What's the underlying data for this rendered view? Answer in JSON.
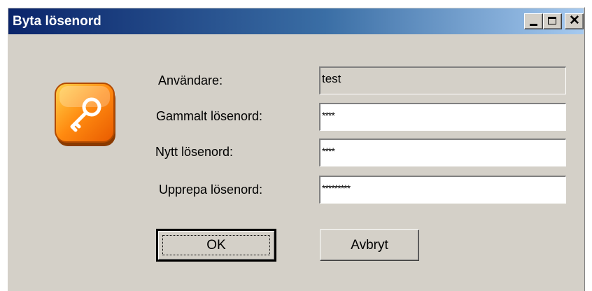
{
  "window": {
    "title": "Byta lösenord",
    "controls": {
      "minimize": "_",
      "maximize": "□",
      "close": "✕"
    }
  },
  "icon": {
    "name": "key-icon",
    "color": "#ff7a00"
  },
  "form": {
    "user_label": "Användare:",
    "user_value": "test",
    "old_password_label": "Gammalt lösenord:",
    "old_password_value": "****",
    "new_password_label": "Nytt lösenord:",
    "new_password_value": "****",
    "repeat_password_label": "Upprepa lösenord:",
    "repeat_password_value": "*********"
  },
  "buttons": {
    "ok": "OK",
    "cancel": "Avbryt"
  }
}
